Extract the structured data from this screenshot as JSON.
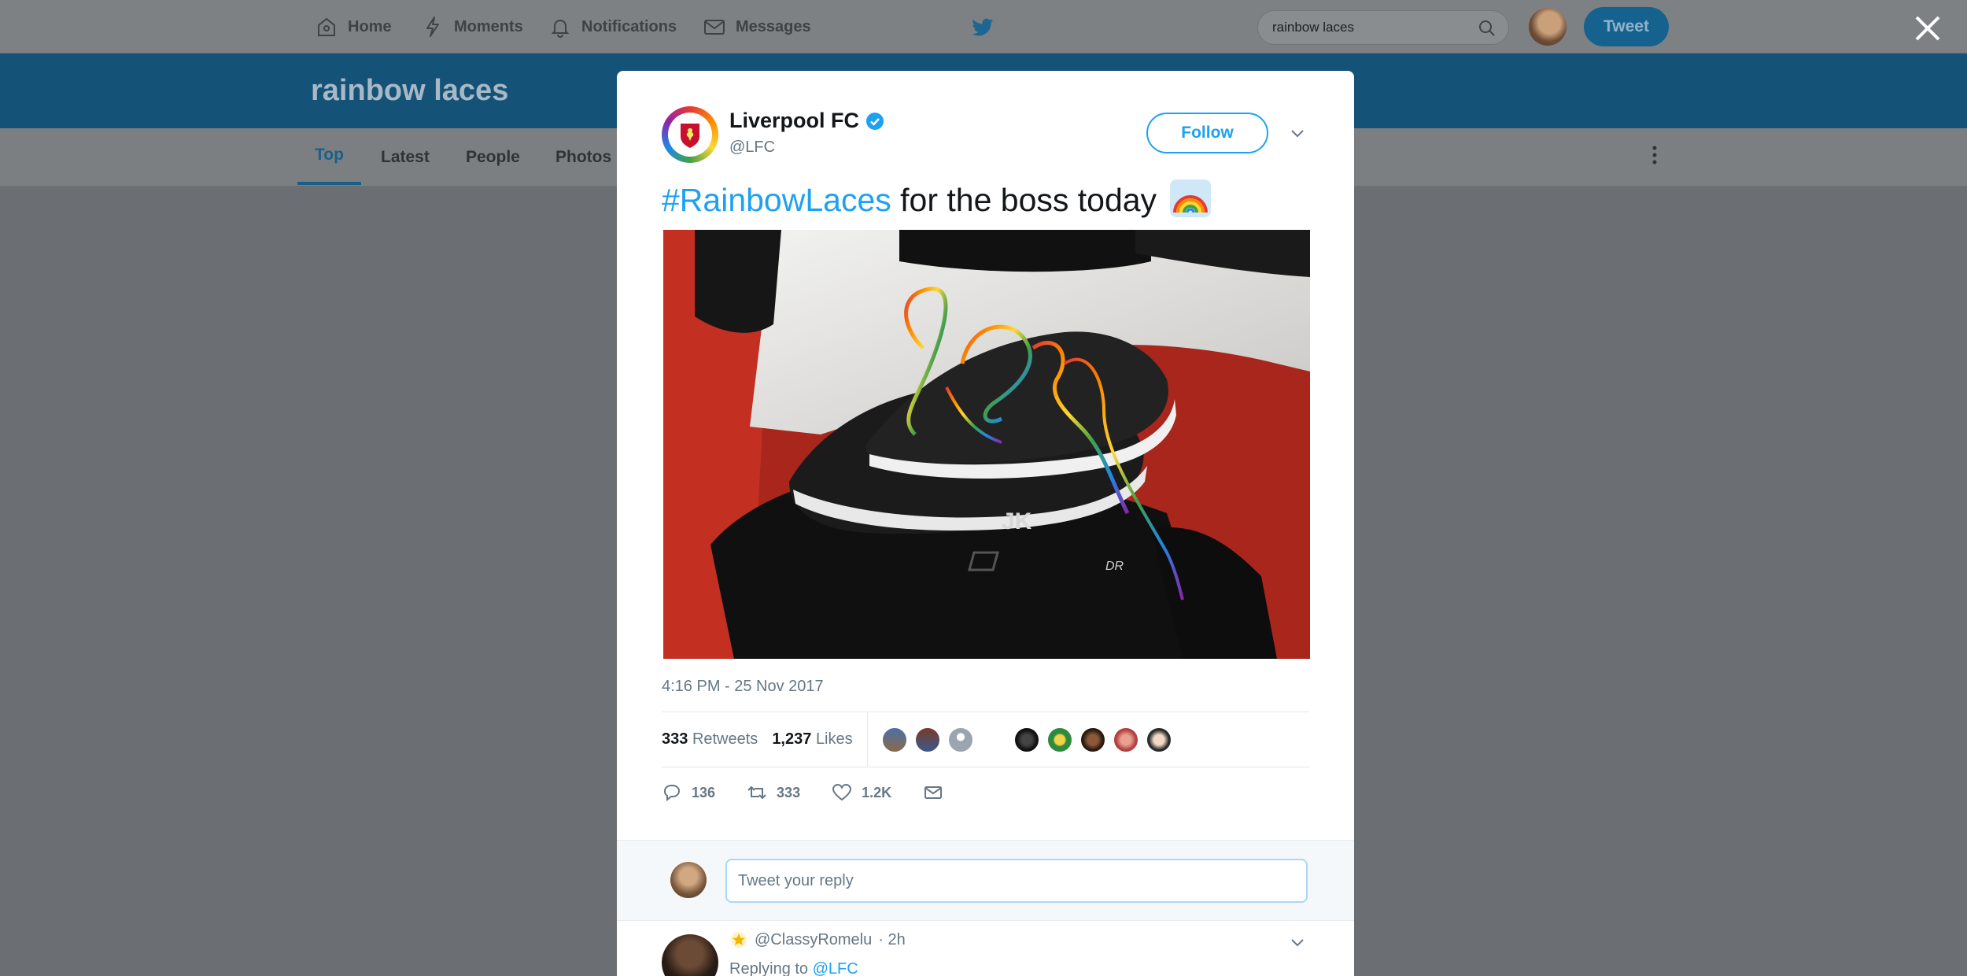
{
  "topnav": {
    "home": "Home",
    "moments": "Moments",
    "notifications": "Notifications",
    "messages": "Messages",
    "search_value": "rainbow laces",
    "tweet_button": "Tweet"
  },
  "search_page": {
    "title": "rainbow laces",
    "tabs": [
      "Top",
      "Latest",
      "People",
      "Photos"
    ],
    "active_tab": "Top"
  },
  "tweet": {
    "author_name": "Liverpool FC",
    "author_handle": "@LFC",
    "verified": true,
    "follow_label": "Follow",
    "hashtag": "#RainbowLaces",
    "text": " for the boss today",
    "emoji": "rainbow",
    "photo_text": [
      "JK",
      "DR"
    ],
    "timestamp": "4:16 PM - 25 Nov 2017",
    "retweets_count": "333",
    "retweets_label": "Retweets",
    "likes_count": "1,237",
    "likes_label": "Likes",
    "actions": {
      "reply_count": "136",
      "retweet_count": "333",
      "like_count": "1.2K"
    }
  },
  "reply_box": {
    "placeholder": "Tweet your reply"
  },
  "first_reply": {
    "handle": "@ClassyRomelu",
    "time": "· 2h",
    "replying_prefix": "Replying to",
    "replying_to": "@LFC"
  },
  "colors": {
    "twitter_blue": "#1da1f2",
    "text_dark": "#14171a",
    "text_gray": "#657786",
    "overlay_bg": "#6b6f73"
  }
}
